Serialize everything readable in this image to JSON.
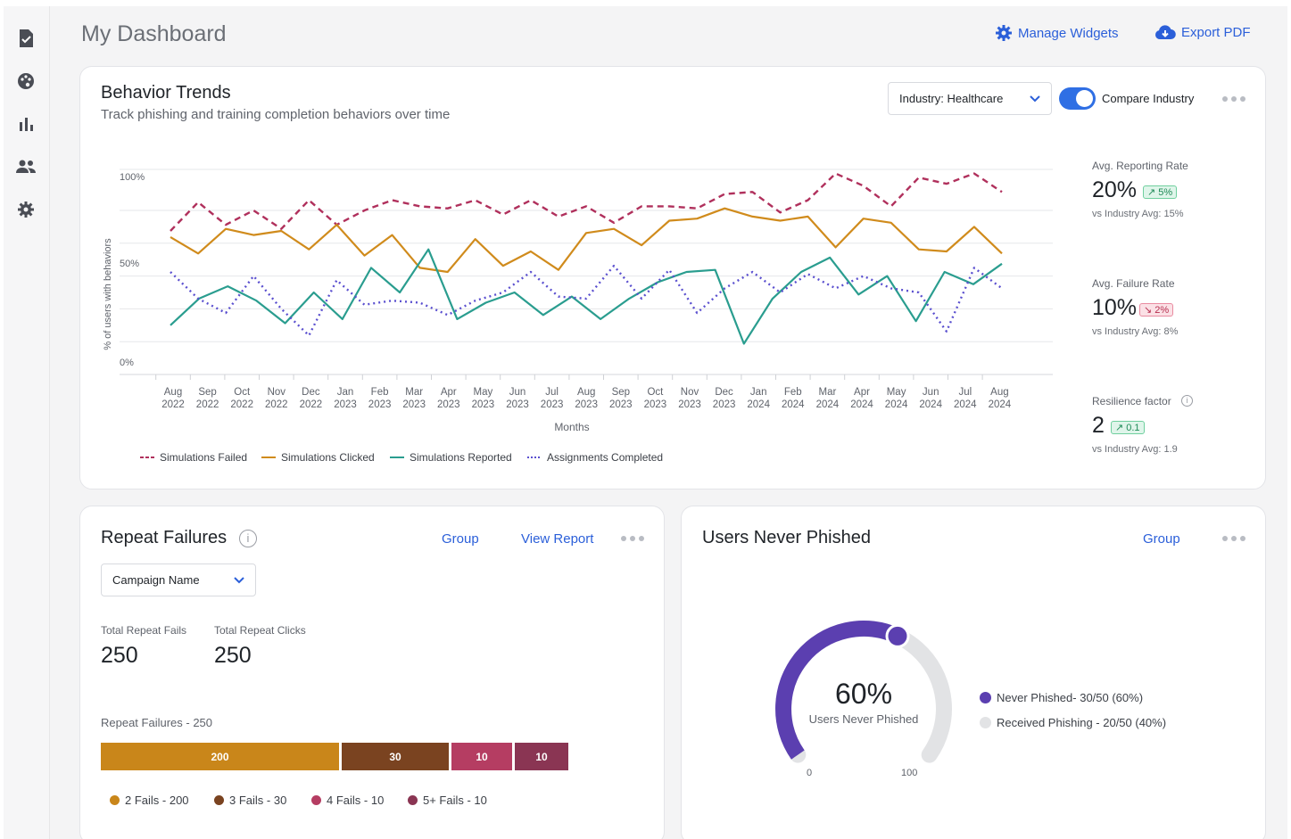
{
  "page": {
    "title": "My Dashboard",
    "manage_widgets": "Manage Widgets",
    "export_pdf": "Export PDF"
  },
  "colors": {
    "accent": "#2b5fd9",
    "failed": "#b0305c",
    "clicked": "#d08b1c",
    "reported": "#2a9d8f",
    "assignments": "#5a4fcf",
    "fails2": "#c9861a",
    "fails3": "#7a4320",
    "fails4": "#b53d62",
    "fails5": "#8a3553",
    "never": "#5b3fb0",
    "received": "#e2e3e5"
  },
  "sidebar": {
    "icons": [
      "document-check-icon",
      "palette-icon",
      "bar-chart-icon",
      "users-icon",
      "gear-icon"
    ]
  },
  "behavior": {
    "title": "Behavior Trends",
    "subtitle": "Track phishing and training completion behaviors over time",
    "industry_select": "Industry: Healthcare",
    "compare_label": "Compare Industry",
    "stats": [
      {
        "label": "Avg. Reporting Rate",
        "value": "20%",
        "badge": "5%",
        "trend": "up",
        "sub": "vs Industry Avg: 15%"
      },
      {
        "label": "Avg. Failure Rate",
        "value": "10%",
        "badge": "2%",
        "trend": "down",
        "sub": "vs Industry Avg: 8%"
      },
      {
        "label": "Resilience factor",
        "value": "2",
        "badge": "0.1",
        "trend": "up",
        "sub": "vs Industry Avg: 1.9"
      }
    ]
  },
  "chart_data": {
    "type": "line",
    "title": "",
    "xlabel": "Months",
    "ylabel": "% of users with behaviors",
    "y_ticks": [
      "100%",
      "50%",
      "0%"
    ],
    "ylim": [
      0,
      100
    ],
    "categories": [
      "Aug 2022",
      "Sep 2022",
      "Oct 2022",
      "Nov 2022",
      "Dec 2022",
      "Jan 2023",
      "Feb 2023",
      "Mar 2023",
      "Apr 2023",
      "May 2023",
      "Jun 2023",
      "Jul 2023",
      "Aug 2023",
      "Sep 2023",
      "Oct 2023",
      "Nov 2023",
      "Dec 2023",
      "Jan 2024",
      "Feb 2024",
      "Mar 2024",
      "Apr 2024",
      "May 2024",
      "Jun 2024",
      "Jul 2024",
      "Aug 2024"
    ],
    "series": [
      {
        "name": "Simulations Failed",
        "style": "dashed",
        "values": [
          70,
          84,
          73,
          80,
          71,
          85,
          73,
          80,
          85,
          82,
          81,
          85,
          78,
          85,
          77,
          82,
          74,
          82,
          82,
          81,
          88,
          89,
          79,
          85,
          98,
          92,
          82,
          96,
          93,
          98,
          89
        ]
      },
      {
        "name": "Simulations Clicked",
        "style": "solid",
        "values": [
          67,
          59,
          71,
          68,
          70,
          61,
          73,
          58,
          68,
          52,
          50,
          66,
          53,
          60,
          51,
          69,
          71,
          63,
          75,
          76,
          81,
          77,
          75,
          77,
          62,
          76,
          74,
          61,
          60,
          72,
          59
        ]
      },
      {
        "name": "Simulations Reported",
        "style": "solid",
        "values": [
          24,
          37,
          43,
          36,
          25,
          40,
          27,
          52,
          40,
          61,
          27,
          35,
          40,
          29,
          38,
          27,
          37,
          45,
          50,
          51,
          15,
          37,
          50,
          57,
          39,
          48,
          26,
          50,
          44,
          54
        ]
      },
      {
        "name": "Assignments Completed",
        "style": "dotted",
        "values": [
          50,
          37,
          30,
          48,
          32,
          19,
          46,
          34,
          36,
          35,
          29,
          36,
          40,
          50,
          38,
          37,
          53,
          37,
          51,
          30,
          42,
          50,
          40,
          49,
          42,
          48,
          42,
          40,
          21,
          52,
          42
        ]
      }
    ]
  },
  "repeat": {
    "title": "Repeat Failures",
    "group": "Group",
    "view_report": "View Report",
    "campaign_select": "Campaign Name",
    "total_fails_label": "Total Repeat Fails",
    "total_fails": "250",
    "total_clicks_label": "Total Repeat Clicks",
    "total_clicks": "250",
    "bar_title": "Repeat Failures - 250",
    "segments": [
      {
        "label": "200",
        "value": 200,
        "legend": "2 Fails - 200"
      },
      {
        "label": "30",
        "value": 30,
        "legend": "3 Fails - 30"
      },
      {
        "label": "10",
        "value": 10,
        "legend": "4 Fails - 10"
      },
      {
        "label": "10",
        "value": 10,
        "legend": "5+ Fails - 10"
      }
    ]
  },
  "never": {
    "title": "Users Never Phished",
    "group": "Group",
    "percent": "60%",
    "caption": "Users Never Phished",
    "fraction": 0.6,
    "min": "0",
    "max": "100",
    "legend_never": "Never Phished- 30/50 (60%)",
    "legend_received": "Received Phishing - 20/50 (40%)"
  }
}
